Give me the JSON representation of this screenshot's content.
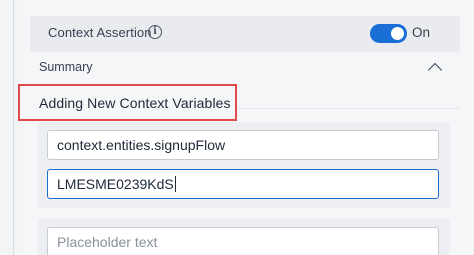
{
  "assertion": {
    "label": "Context Assertion",
    "info_icon": "info-circle-icon",
    "toggle_state": true,
    "toggle_label": "On",
    "toggle_color": "#1a6fd6"
  },
  "summary": {
    "label": "Summary",
    "chevron_icon": "chevron-up-icon"
  },
  "section": {
    "heading": "Adding New Context Variables",
    "highlight_color": "#e04a4a"
  },
  "fields": {
    "entity_value": "context.entities.signupFlow",
    "variable_value": "LMESME0239KdS",
    "placeholder": "Placeholder text"
  }
}
